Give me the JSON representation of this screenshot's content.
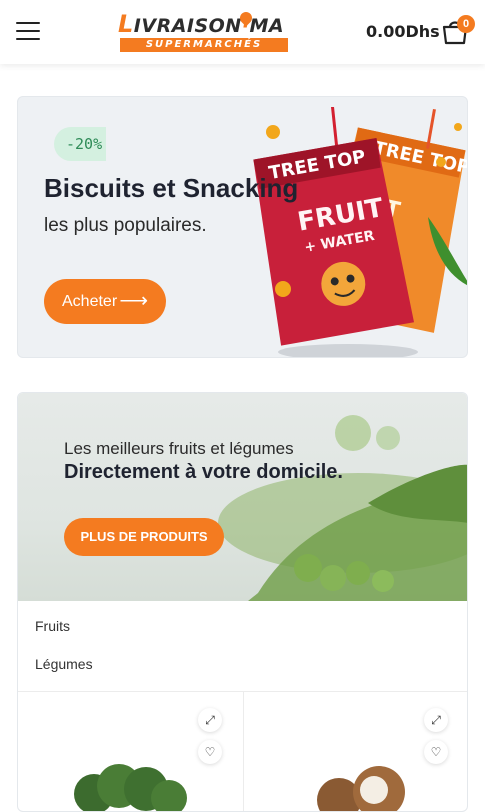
{
  "header": {
    "menu_icon": "hamburger-menu-icon",
    "logo_top": "IVRAISON",
    "logo_first_letter": "L",
    "logo_suffix": "MA",
    "logo_bottom": "SUPERMARCHÉS",
    "cart_total": "0.00Dhs",
    "cart_icon": "shopping-bag-icon",
    "cart_count": "0"
  },
  "promo": {
    "badge": "-20%",
    "title": "Biscuits et Snacking",
    "subtitle": "les plus populaires.",
    "button_label": "Acheter",
    "button_icon": "arrow-right-icon",
    "product_brand": "TREE TOP",
    "product_name_line1": "FRUIT",
    "product_name_line2": "+ WATER"
  },
  "fruits_banner": {
    "line1": "Les meilleurs fruits et légumes",
    "line2": "Directement à votre domicile.",
    "button_label": "PLUS DE PRODUITS"
  },
  "categories": [
    "Fruits",
    "Légumes"
  ],
  "products": [
    {
      "image": "broccoli",
      "expand_icon": "expand-icon",
      "wishlist_icon": "heart-icon"
    },
    {
      "image": "coconut",
      "expand_icon": "expand-icon",
      "wishlist_icon": "heart-icon"
    }
  ],
  "colors": {
    "accent": "#f47b20",
    "badge_bg": "#d4f0e0",
    "badge_text": "#2e8b57",
    "promo_bg": "#eef1f4"
  }
}
